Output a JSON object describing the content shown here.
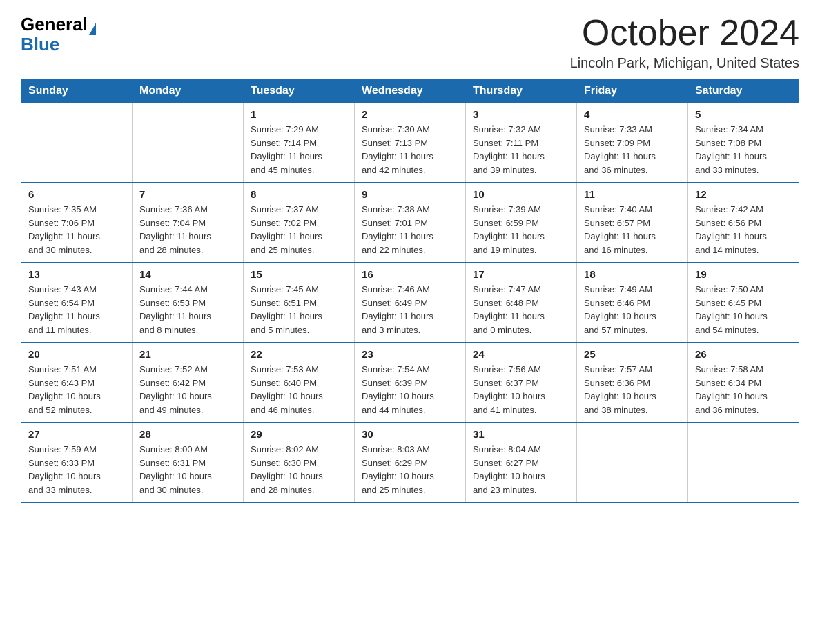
{
  "logo": {
    "general": "General",
    "blue": "Blue"
  },
  "title": "October 2024",
  "location": "Lincoln Park, Michigan, United States",
  "weekdays": [
    "Sunday",
    "Monday",
    "Tuesday",
    "Wednesday",
    "Thursday",
    "Friday",
    "Saturday"
  ],
  "weeks": [
    [
      {
        "day": "",
        "info": ""
      },
      {
        "day": "",
        "info": ""
      },
      {
        "day": "1",
        "info": "Sunrise: 7:29 AM\nSunset: 7:14 PM\nDaylight: 11 hours\nand 45 minutes."
      },
      {
        "day": "2",
        "info": "Sunrise: 7:30 AM\nSunset: 7:13 PM\nDaylight: 11 hours\nand 42 minutes."
      },
      {
        "day": "3",
        "info": "Sunrise: 7:32 AM\nSunset: 7:11 PM\nDaylight: 11 hours\nand 39 minutes."
      },
      {
        "day": "4",
        "info": "Sunrise: 7:33 AM\nSunset: 7:09 PM\nDaylight: 11 hours\nand 36 minutes."
      },
      {
        "day": "5",
        "info": "Sunrise: 7:34 AM\nSunset: 7:08 PM\nDaylight: 11 hours\nand 33 minutes."
      }
    ],
    [
      {
        "day": "6",
        "info": "Sunrise: 7:35 AM\nSunset: 7:06 PM\nDaylight: 11 hours\nand 30 minutes."
      },
      {
        "day": "7",
        "info": "Sunrise: 7:36 AM\nSunset: 7:04 PM\nDaylight: 11 hours\nand 28 minutes."
      },
      {
        "day": "8",
        "info": "Sunrise: 7:37 AM\nSunset: 7:02 PM\nDaylight: 11 hours\nand 25 minutes."
      },
      {
        "day": "9",
        "info": "Sunrise: 7:38 AM\nSunset: 7:01 PM\nDaylight: 11 hours\nand 22 minutes."
      },
      {
        "day": "10",
        "info": "Sunrise: 7:39 AM\nSunset: 6:59 PM\nDaylight: 11 hours\nand 19 minutes."
      },
      {
        "day": "11",
        "info": "Sunrise: 7:40 AM\nSunset: 6:57 PM\nDaylight: 11 hours\nand 16 minutes."
      },
      {
        "day": "12",
        "info": "Sunrise: 7:42 AM\nSunset: 6:56 PM\nDaylight: 11 hours\nand 14 minutes."
      }
    ],
    [
      {
        "day": "13",
        "info": "Sunrise: 7:43 AM\nSunset: 6:54 PM\nDaylight: 11 hours\nand 11 minutes."
      },
      {
        "day": "14",
        "info": "Sunrise: 7:44 AM\nSunset: 6:53 PM\nDaylight: 11 hours\nand 8 minutes."
      },
      {
        "day": "15",
        "info": "Sunrise: 7:45 AM\nSunset: 6:51 PM\nDaylight: 11 hours\nand 5 minutes."
      },
      {
        "day": "16",
        "info": "Sunrise: 7:46 AM\nSunset: 6:49 PM\nDaylight: 11 hours\nand 3 minutes."
      },
      {
        "day": "17",
        "info": "Sunrise: 7:47 AM\nSunset: 6:48 PM\nDaylight: 11 hours\nand 0 minutes."
      },
      {
        "day": "18",
        "info": "Sunrise: 7:49 AM\nSunset: 6:46 PM\nDaylight: 10 hours\nand 57 minutes."
      },
      {
        "day": "19",
        "info": "Sunrise: 7:50 AM\nSunset: 6:45 PM\nDaylight: 10 hours\nand 54 minutes."
      }
    ],
    [
      {
        "day": "20",
        "info": "Sunrise: 7:51 AM\nSunset: 6:43 PM\nDaylight: 10 hours\nand 52 minutes."
      },
      {
        "day": "21",
        "info": "Sunrise: 7:52 AM\nSunset: 6:42 PM\nDaylight: 10 hours\nand 49 minutes."
      },
      {
        "day": "22",
        "info": "Sunrise: 7:53 AM\nSunset: 6:40 PM\nDaylight: 10 hours\nand 46 minutes."
      },
      {
        "day": "23",
        "info": "Sunrise: 7:54 AM\nSunset: 6:39 PM\nDaylight: 10 hours\nand 44 minutes."
      },
      {
        "day": "24",
        "info": "Sunrise: 7:56 AM\nSunset: 6:37 PM\nDaylight: 10 hours\nand 41 minutes."
      },
      {
        "day": "25",
        "info": "Sunrise: 7:57 AM\nSunset: 6:36 PM\nDaylight: 10 hours\nand 38 minutes."
      },
      {
        "day": "26",
        "info": "Sunrise: 7:58 AM\nSunset: 6:34 PM\nDaylight: 10 hours\nand 36 minutes."
      }
    ],
    [
      {
        "day": "27",
        "info": "Sunrise: 7:59 AM\nSunset: 6:33 PM\nDaylight: 10 hours\nand 33 minutes."
      },
      {
        "day": "28",
        "info": "Sunrise: 8:00 AM\nSunset: 6:31 PM\nDaylight: 10 hours\nand 30 minutes."
      },
      {
        "day": "29",
        "info": "Sunrise: 8:02 AM\nSunset: 6:30 PM\nDaylight: 10 hours\nand 28 minutes."
      },
      {
        "day": "30",
        "info": "Sunrise: 8:03 AM\nSunset: 6:29 PM\nDaylight: 10 hours\nand 25 minutes."
      },
      {
        "day": "31",
        "info": "Sunrise: 8:04 AM\nSunset: 6:27 PM\nDaylight: 10 hours\nand 23 minutes."
      },
      {
        "day": "",
        "info": ""
      },
      {
        "day": "",
        "info": ""
      }
    ]
  ]
}
